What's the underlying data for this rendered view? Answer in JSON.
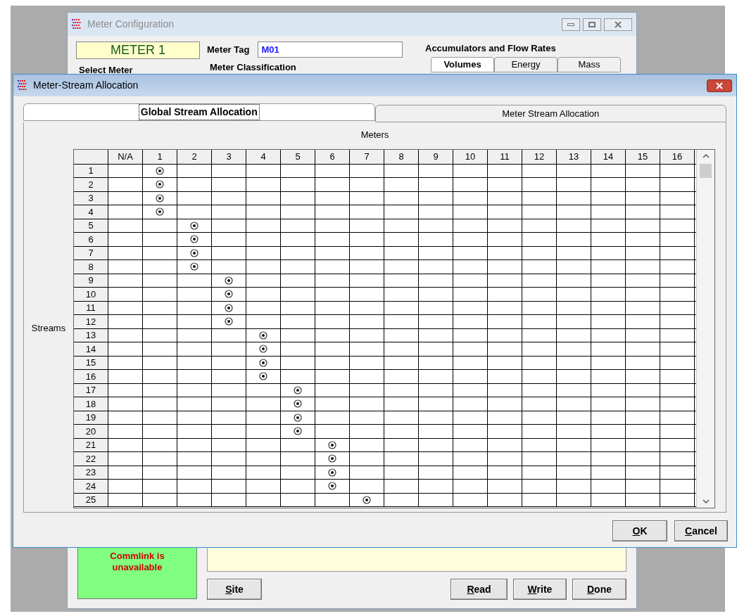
{
  "background_window": {
    "title": "Meter Configuration",
    "meter_name": "METER 1",
    "meter_tag_label": "Meter Tag",
    "meter_tag": "M01",
    "groups": [
      "Select Meter",
      "Meter Classification"
    ],
    "accumulators": {
      "title": "Accumulators and Flow Rates",
      "tabs": [
        {
          "label": "Volumes",
          "selected": true
        },
        {
          "label": "Energy",
          "selected": false
        },
        {
          "label": "Mass",
          "selected": false
        }
      ]
    },
    "status": "Commlink is unavailable",
    "buttons": [
      "Site",
      "Read",
      "Write",
      "Done"
    ]
  },
  "dialog": {
    "title": "Meter-Stream Allocation",
    "tabs": [
      {
        "label": "Global Stream Allocation",
        "selected": true
      },
      {
        "label": "Meter Stream Allocation",
        "selected": false
      }
    ],
    "meters_label": "Meters",
    "streams_label": "Streams",
    "columns": [
      "N/A",
      "1",
      "2",
      "3",
      "4",
      "5",
      "6",
      "7",
      "8",
      "9",
      "10",
      "11",
      "12",
      "13",
      "14",
      "15",
      "16"
    ],
    "rows": [
      {
        "stream": "1",
        "cells": [
          false,
          true,
          false,
          false,
          false,
          false,
          false,
          false,
          false,
          false,
          false,
          false,
          false,
          false,
          false,
          false,
          false
        ]
      },
      {
        "stream": "2",
        "cells": [
          false,
          true,
          false,
          false,
          false,
          false,
          false,
          false,
          false,
          false,
          false,
          false,
          false,
          false,
          false,
          false,
          false
        ]
      },
      {
        "stream": "3",
        "cells": [
          false,
          true,
          false,
          false,
          false,
          false,
          false,
          false,
          false,
          false,
          false,
          false,
          false,
          false,
          false,
          false,
          false
        ]
      },
      {
        "stream": "4",
        "cells": [
          false,
          true,
          false,
          false,
          false,
          false,
          false,
          false,
          false,
          false,
          false,
          false,
          false,
          false,
          false,
          false,
          false
        ]
      },
      {
        "stream": "5",
        "cells": [
          false,
          false,
          true,
          false,
          false,
          false,
          false,
          false,
          false,
          false,
          false,
          false,
          false,
          false,
          false,
          false,
          false
        ]
      },
      {
        "stream": "6",
        "cells": [
          false,
          false,
          true,
          false,
          false,
          false,
          false,
          false,
          false,
          false,
          false,
          false,
          false,
          false,
          false,
          false,
          false
        ]
      },
      {
        "stream": "7",
        "cells": [
          false,
          false,
          true,
          false,
          false,
          false,
          false,
          false,
          false,
          false,
          false,
          false,
          false,
          false,
          false,
          false,
          false
        ]
      },
      {
        "stream": "8",
        "cells": [
          false,
          false,
          true,
          false,
          false,
          false,
          false,
          false,
          false,
          false,
          false,
          false,
          false,
          false,
          false,
          false,
          false
        ]
      },
      {
        "stream": "9",
        "cells": [
          false,
          false,
          false,
          true,
          false,
          false,
          false,
          false,
          false,
          false,
          false,
          false,
          false,
          false,
          false,
          false,
          false
        ]
      },
      {
        "stream": "10",
        "cells": [
          false,
          false,
          false,
          true,
          false,
          false,
          false,
          false,
          false,
          false,
          false,
          false,
          false,
          false,
          false,
          false,
          false
        ]
      },
      {
        "stream": "11",
        "cells": [
          false,
          false,
          false,
          true,
          false,
          false,
          false,
          false,
          false,
          false,
          false,
          false,
          false,
          false,
          false,
          false,
          false
        ]
      },
      {
        "stream": "12",
        "cells": [
          false,
          false,
          false,
          true,
          false,
          false,
          false,
          false,
          false,
          false,
          false,
          false,
          false,
          false,
          false,
          false,
          false
        ]
      },
      {
        "stream": "13",
        "cells": [
          false,
          false,
          false,
          false,
          true,
          false,
          false,
          false,
          false,
          false,
          false,
          false,
          false,
          false,
          false,
          false,
          false
        ]
      },
      {
        "stream": "14",
        "cells": [
          false,
          false,
          false,
          false,
          true,
          false,
          false,
          false,
          false,
          false,
          false,
          false,
          false,
          false,
          false,
          false,
          false
        ]
      },
      {
        "stream": "15",
        "cells": [
          false,
          false,
          false,
          false,
          true,
          false,
          false,
          false,
          false,
          false,
          false,
          false,
          false,
          false,
          false,
          false,
          false
        ]
      },
      {
        "stream": "16",
        "cells": [
          false,
          false,
          false,
          false,
          true,
          false,
          false,
          false,
          false,
          false,
          false,
          false,
          false,
          false,
          false,
          false,
          false
        ]
      },
      {
        "stream": "17",
        "cells": [
          false,
          false,
          false,
          false,
          false,
          true,
          false,
          false,
          false,
          false,
          false,
          false,
          false,
          false,
          false,
          false,
          false
        ]
      },
      {
        "stream": "18",
        "cells": [
          false,
          false,
          false,
          false,
          false,
          true,
          false,
          false,
          false,
          false,
          false,
          false,
          false,
          false,
          false,
          false,
          false
        ]
      },
      {
        "stream": "19",
        "cells": [
          false,
          false,
          false,
          false,
          false,
          true,
          false,
          false,
          false,
          false,
          false,
          false,
          false,
          false,
          false,
          false,
          false
        ]
      },
      {
        "stream": "20",
        "cells": [
          false,
          false,
          false,
          false,
          false,
          true,
          false,
          false,
          false,
          false,
          false,
          false,
          false,
          false,
          false,
          false,
          false
        ]
      },
      {
        "stream": "21",
        "cells": [
          false,
          false,
          false,
          false,
          false,
          false,
          true,
          false,
          false,
          false,
          false,
          false,
          false,
          false,
          false,
          false,
          false
        ]
      },
      {
        "stream": "22",
        "cells": [
          false,
          false,
          false,
          false,
          false,
          false,
          true,
          false,
          false,
          false,
          false,
          false,
          false,
          false,
          false,
          false,
          false
        ]
      },
      {
        "stream": "23",
        "cells": [
          false,
          false,
          false,
          false,
          false,
          false,
          true,
          false,
          false,
          false,
          false,
          false,
          false,
          false,
          false,
          false,
          false
        ]
      },
      {
        "stream": "24",
        "cells": [
          false,
          false,
          false,
          false,
          false,
          false,
          true,
          false,
          false,
          false,
          false,
          false,
          false,
          false,
          false,
          false,
          false
        ]
      },
      {
        "stream": "25",
        "cells": [
          false,
          false,
          false,
          false,
          false,
          false,
          false,
          true,
          false,
          false,
          false,
          false,
          false,
          false,
          false,
          false,
          false
        ]
      }
    ],
    "buttons": [
      "OK",
      "Cancel"
    ]
  }
}
